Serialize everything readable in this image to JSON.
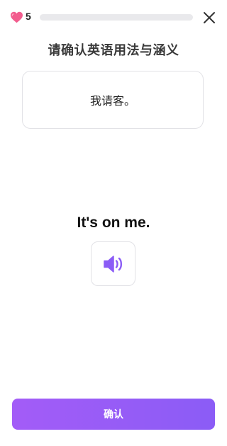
{
  "header": {
    "lives": "5",
    "progress_fraction": 0.0,
    "heart_icon": "heart-icon",
    "close_icon": "close-icon"
  },
  "question": {
    "title": "请确认英语用法与涵义",
    "chinese_sentence": "我请客。"
  },
  "phrase": {
    "english": "It's on me.",
    "audio_icon": "speaker-icon"
  },
  "footer": {
    "confirm_label": "确认"
  },
  "colors": {
    "accent": "#8b5cf6",
    "heart": "#f25d8e",
    "progress_track": "#e9e9ec"
  }
}
